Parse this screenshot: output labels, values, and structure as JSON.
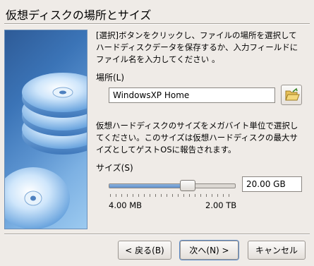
{
  "header": {
    "title": "仮想ディスクの場所とサイズ"
  },
  "description": {
    "line1": "[選択]ボタンをクリックし、ファイルの場所を選択して",
    "line2": "ハードディスクデータを保存するか、入力フィールドに",
    "line3": "ファイル名を入力してください 。"
  },
  "location": {
    "label": "場所(L)",
    "value": "WindowsXP Home",
    "folder_icon": "folder-open-icon"
  },
  "size_description": {
    "line1": "仮想ハードディスクのサイズをメガバイト単位で選択し",
    "line2": "てください。このサイズは仮想ハードディスクの最大サ",
    "line3": "イズとしてゲストOSに報告されます。"
  },
  "size": {
    "label": "サイズ(S)",
    "value": "20.00 GB",
    "min_label": "4.00 MB",
    "max_label": "2.00 TB",
    "slider_fraction": 0.62
  },
  "buttons": {
    "back": "< 戻る(B)",
    "next": "次へ(N) >",
    "cancel": "キャンセル"
  },
  "colors": {
    "accent": "#5e8fcb",
    "banner": "#3b74b7"
  }
}
